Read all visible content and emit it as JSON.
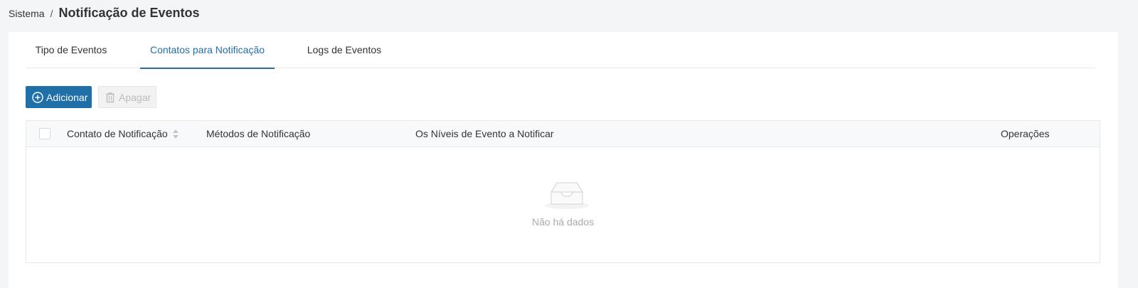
{
  "breadcrumb": {
    "parent": "Sistema",
    "separator": "/",
    "title": "Notificação de Eventos"
  },
  "tabs": [
    {
      "label": "Tipo de Eventos",
      "active": false
    },
    {
      "label": "Contatos para Notificação",
      "active": true
    },
    {
      "label": "Logs de Eventos",
      "active": false
    }
  ],
  "toolbar": {
    "add_label": "Adicionar",
    "delete_label": "Apagar"
  },
  "table": {
    "columns": [
      "Contato de Notificação",
      "Métodos de Notificação",
      "Os Níveis de Evento a Notificar",
      "Operações"
    ],
    "empty_text": "Não há dados"
  },
  "colors": {
    "accent": "#1f6fa8",
    "background": "#f4f5f7",
    "panel": "#ffffff"
  },
  "icons": {
    "add": "plus-circle-icon",
    "delete": "trash-icon",
    "sort": "sort-icon",
    "empty": "inbox-icon"
  }
}
